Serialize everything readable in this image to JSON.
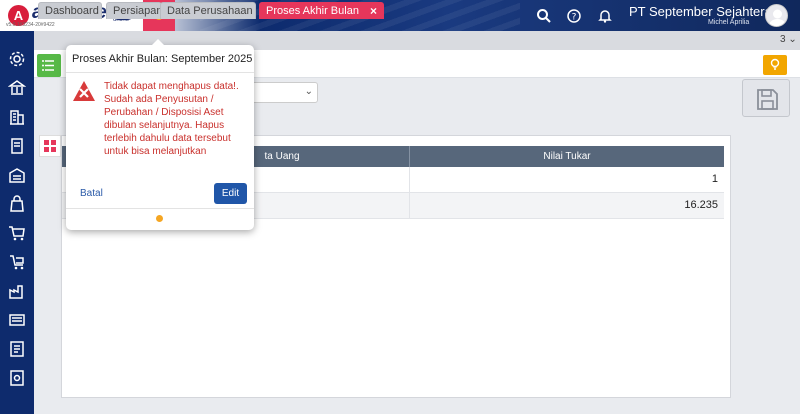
{
  "header": {
    "logo_letter": "A",
    "logo_text": "accurate",
    "logo_sub": "online",
    "version": "v5.0.1#3234-20#9422",
    "company": "PT September Sejahtera",
    "user": "Michel Aprilia",
    "icons": [
      "search-icon",
      "help-icon",
      "bell-icon"
    ]
  },
  "sidebar": {
    "items": [
      "gear-icon",
      "bank-icon",
      "building-icon",
      "ledger-icon",
      "warehouse-icon",
      "bag-icon",
      "cart-icon",
      "delivery-icon",
      "factory-icon",
      "register-icon",
      "report-icon",
      "setting-doc-icon"
    ]
  },
  "tabs": [
    {
      "label": "Dashboard"
    },
    {
      "label": "Persiapan"
    },
    {
      "label": "Data Perusahaan"
    },
    {
      "label": "Proses Akhir Bulan",
      "close": "×"
    }
  ],
  "tab_count": "3 ⌄",
  "table": {
    "columns": [
      "ta Uang",
      "Nilai Tukar"
    ],
    "rows": [
      {
        "value": "1"
      },
      {
        "value": "16.235"
      }
    ]
  },
  "popup": {
    "title": "Proses Akhir Bulan: September 2025",
    "message": "Tidak dapat menghapus data!. Sudah ada Penyusutan / Perubahan / Disposisi Aset dibulan selanjutnya. Hapus terlebih dahulu data tersebut untuk bisa melanjutkan",
    "cancel_label": "Batal",
    "edit_label": "Edit"
  },
  "colors": {
    "primary": "#0e2b6d",
    "accent": "#e6365b",
    "error": "#c9302c",
    "button": "#2056a8"
  }
}
